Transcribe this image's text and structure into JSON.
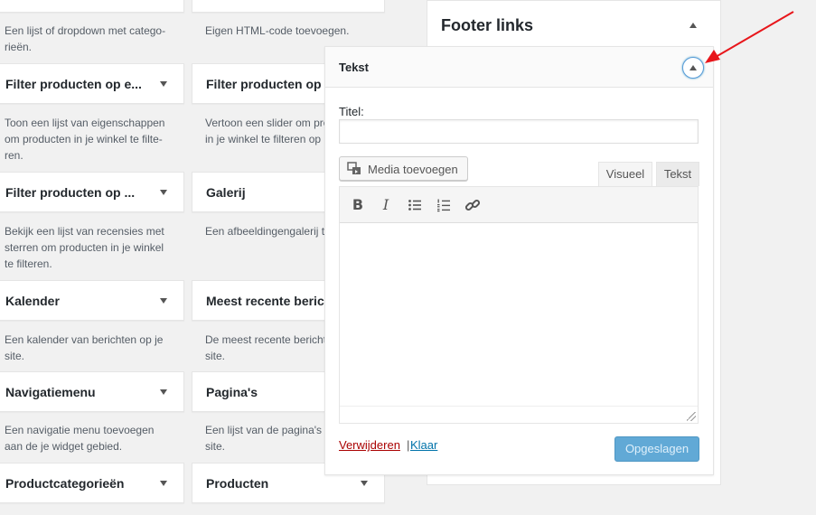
{
  "available_widgets": {
    "left": [
      {
        "title": "",
        "desc": "Een lijst of dropdown met catego-\nrieën."
      },
      {
        "title": "Filter producten op e...",
        "desc": "Toon een lijst van eigenschappen\nom producten in je winkel te filte-\nren."
      },
      {
        "title": "Filter producten op ...",
        "desc": "Bekijk een lijst van recensies met\nsterren om producten in je winkel\nte filteren."
      },
      {
        "title": "Kalender",
        "desc": "Een kalender van berichten op je\nsite."
      },
      {
        "title": "Navigatiemenu",
        "desc": "Een navigatie menu toevoegen\naan de je widget gebied."
      },
      {
        "title": "Productcategorieën",
        "desc": ""
      }
    ],
    "middle": [
      {
        "title": "",
        "desc": "Eigen HTML-code toevoegen."
      },
      {
        "title": "Filter producten op ...",
        "desc": "Vertoon een slider om producten\nin je winkel te filteren op"
      },
      {
        "title": "Galerij",
        "desc": "Een afbeeldingengalerij to"
      },
      {
        "title": "Meest recente berich...",
        "desc": "De meest recente berichten\nsite."
      },
      {
        "title": "Pagina's",
        "desc": "Een lijst van de pagina's o\nsite."
      },
      {
        "title": "Producten",
        "desc": ""
      }
    ]
  },
  "sidebar": {
    "title": "Footer links"
  },
  "widget_panel": {
    "title": "Tekst",
    "title_label": "Titel:",
    "title_value": "",
    "media_button": "Media toevoegen",
    "tab_visual": "Visueel",
    "tab_text": "Tekst",
    "toolbar": {
      "bold": "B",
      "italic": "I",
      "bullet_list": "☰",
      "numbered_list": "☷",
      "link": "🔗"
    },
    "delete_link": "Verwijderen",
    "separator": "|",
    "done_link": "Klaar",
    "save_button": "Opgeslagen"
  },
  "colors": {
    "annotation_arrow": "#e8161b",
    "link_blue": "#0073aa",
    "delete_red": "#a00"
  }
}
